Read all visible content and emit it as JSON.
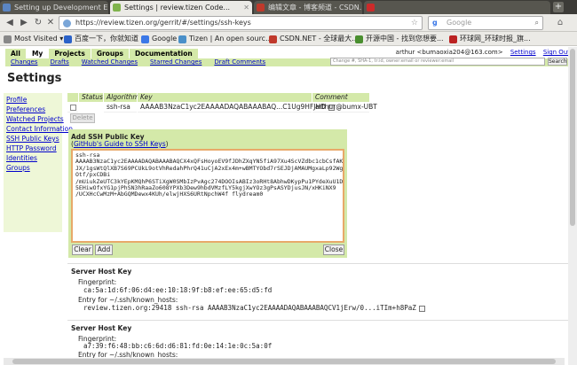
{
  "tabs": [
    {
      "label": "Setting up Development En...",
      "active": false,
      "favicon_color": "#5b85c2"
    },
    {
      "label": "Settings | review.tizen Code...",
      "active": true,
      "favicon_color": "#7fb34d"
    },
    {
      "label": "编辑文章 - 博客频道 - CSDN...",
      "active": false,
      "favicon_color": "#c0392b"
    }
  ],
  "url": "https://review.tizen.org/gerrit/#/settings/ssh-keys",
  "search": {
    "engine_glyph": "g",
    "placeholder": "Google"
  },
  "bookmarks": [
    {
      "label": "Most Visited ▾",
      "icon_color": "#888"
    },
    {
      "label": "百度一下，你就知道",
      "icon_color": "#2b62c8"
    },
    {
      "label": "Google",
      "icon_color": "#3b78e7"
    },
    {
      "label": "Tizen | An open sourc...",
      "icon_color": "#4a90c9"
    },
    {
      "label": "CSDN.NET - 全球最大...",
      "icon_color": "#c0392b"
    },
    {
      "label": "开源中国 - 找到您想要...",
      "icon_color": "#4a8f2f"
    },
    {
      "label": "环球网_环球时报_旗...",
      "icon_color": "#b22"
    }
  ],
  "topmenu": [
    "All",
    "My",
    "Projects",
    "Groups",
    "Documentation"
  ],
  "topmenu_selected": "My",
  "submenu": [
    "Changes",
    "Drafts",
    "Watched Changes",
    "Starred Changes",
    "Draft Comments"
  ],
  "user": {
    "name": "arthur <bumaoxia204@163.com>",
    "settings": "Settings",
    "signout": "Sign Out"
  },
  "search_field_placeholder": "Change #, SHA-1, tr:id, owner:email or reviewer:email",
  "search_button": "Search",
  "page_title": "Settings",
  "sidenav": [
    "Profile",
    "Preferences",
    "Watched Projects",
    "Contact Information",
    "SSH Public Keys",
    "HTTP Password",
    "Identities",
    "Groups"
  ],
  "key_table": {
    "headers": [
      "Status",
      "Algorithm",
      "Key",
      "Comment"
    ],
    "row": {
      "algorithm": "ssh-rsa",
      "key": "AAAAB3NzaC1yc2EAAAADAQABAAABAQ...C1Ug9HFJHD",
      "comment": "arthur@bumx-UBT"
    }
  },
  "delete_button": "Delete",
  "add_key": {
    "title": "Add SSH Public Key",
    "guide_open": "(",
    "guide_link": "GitHub's Guide to SSH Keys",
    "guide_close": ")",
    "lines": [
      "ssh-rsa",
      "AAAAB3NzaC1yc2EAAAADAQABAAABAQCX4xQFsHoyoEV9fJDhZXqYN5fiA97Xu4ScVZdbc1cbCsfAKiHDx",
      "JX/1gsWtQlXB7S69PCUkL9otVhRedahPhrQ41uCjA2xEx4m+wBMTYObd7rSEJDjAMAUMgxaLp92WgJAfk",
      "Otf/pxCDBi",
      "/mUiukZeUTC3kYEpKMQhP6STiXgW0SMbIzPvAgc274DOOIsABIz3oRHt8AbhwDKypPu1PYdeXuU1DQX9l",
      "5EHiwOfxYG1pjPhSN3hRaaZo608YPXb3Dew9hbdVMzfLY5kgjXwYOz3gPsASYDjusJN/xHKiNX9",
      "/UCXHcCwMzM+AbGQMDewx4KUh/elwjHXS6URtNpchW4f flydream0"
    ]
  },
  "buttons": {
    "clear": "Clear",
    "add": "Add",
    "close": "Close"
  },
  "host_keys": [
    {
      "title": "Server Host Key",
      "fingerprint_label": "Fingerprint:",
      "fingerprint": "ca:5a:1d:6f:06:d4:ee:10:18:9f:b8:ef:ee:65:d5:fd",
      "entry_label": "Entry for ~/.ssh/known_hosts:",
      "entry": "review.tizen.org:29418 ssh-rsa AAAAB3NzaC1yc2EAAAADAQABAAABAQCV1jErw/0...iTIm+h8PaZ"
    },
    {
      "title": "Server Host Key",
      "fingerprint_label": "Fingerprint:",
      "fingerprint": "a7:39:f6:48:bb:c6:6d:d6:81:fd:0e:14:1e:0c:5a:0f",
      "entry_label": "Entry for ~/.ssh/known_hosts:",
      "entry": ""
    }
  ]
}
